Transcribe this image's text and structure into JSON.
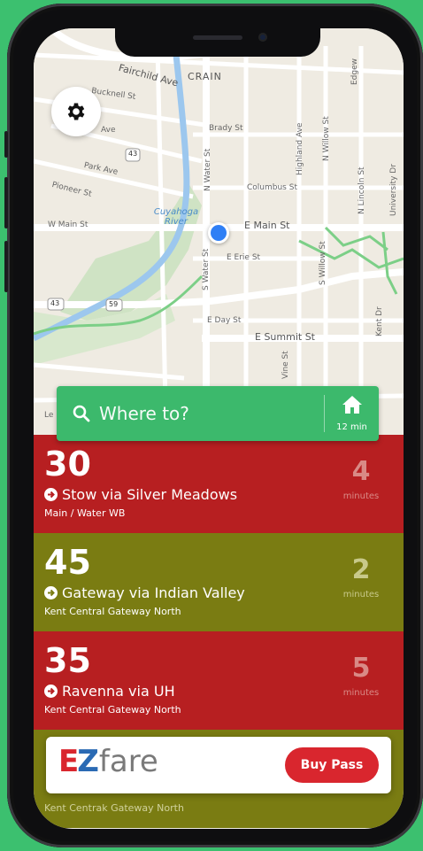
{
  "map": {
    "labels": {
      "fairchild_ave": "Fairchild Ave",
      "crain": "CRAIN",
      "bucknell_st": "Bucknell St",
      "ave": "Ave",
      "brady_st": "Brady St",
      "route_43": "43",
      "park_ave": "Park Ave",
      "pioneer_st": "Pioneer St",
      "n_water_st": "N Water St",
      "columbus_st": "Columbus St",
      "cuyahoga_river_1": "Cuyahoga",
      "cuyahoga_river_2": "River",
      "w_main_st": "W Main St",
      "e_main_st": "E Main St",
      "e_erie_st": "E Erie St",
      "s_water_st": "S Water St",
      "highland_ave": "Highland Ave",
      "n_willow_st": "N Willow St",
      "n_lincoln_st": "N Lincoln St",
      "university_dr": "University Dr",
      "s_willow_st": "S Willow St",
      "route_43b": "43",
      "route_59": "59",
      "e_day_st": "E Day St",
      "e_summit_st": "E Summit St",
      "vine_st": "Vine St",
      "kent_dr": "Kent Dr",
      "edgewood": "Edgew"
    },
    "legal": "Le"
  },
  "search": {
    "placeholder": "Where to?",
    "home_time": "12 min"
  },
  "routes": [
    {
      "number": "30",
      "destination": "Stow via Silver Meadows",
      "stop": "Main / Water WB",
      "minutes": "4",
      "minutes_label": "minutes",
      "color": "#b71f21",
      "minutes_color": "#d98a86"
    },
    {
      "number": "45",
      "destination": "Gateway via Indian Valley",
      "stop": "Kent Central Gateway North",
      "minutes": "2",
      "minutes_label": "minutes",
      "color": "#7a7c12",
      "minutes_color": "#c8c98a"
    },
    {
      "number": "35",
      "destination": "Ravenna via UH",
      "stop": "Kent Central Gateway North",
      "minutes": "5",
      "minutes_label": "minutes",
      "color": "#b71f21",
      "minutes_color": "#d98a86"
    },
    {
      "number": "",
      "destination": "",
      "stop": "",
      "minutes": "",
      "minutes_label": "",
      "color": "#7a7c12",
      "minutes_color": "#c8c98a"
    }
  ],
  "under_banner_stop": "Kent Centrak Gateway North",
  "banner": {
    "logo_e": "E",
    "logo_z": "Z",
    "logo_fare": "fare",
    "buy_label": "Buy Pass"
  },
  "colors": {
    "background": "#3cc06f",
    "search_green": "#3cb96c",
    "route_red": "#b71f21",
    "route_olive": "#7a7c12",
    "location_blue": "#2f7ff5",
    "buy_red": "#d9262e"
  },
  "icons": [
    "gear-icon",
    "search-icon",
    "home-icon",
    "arrow-right-circle-icon"
  ]
}
